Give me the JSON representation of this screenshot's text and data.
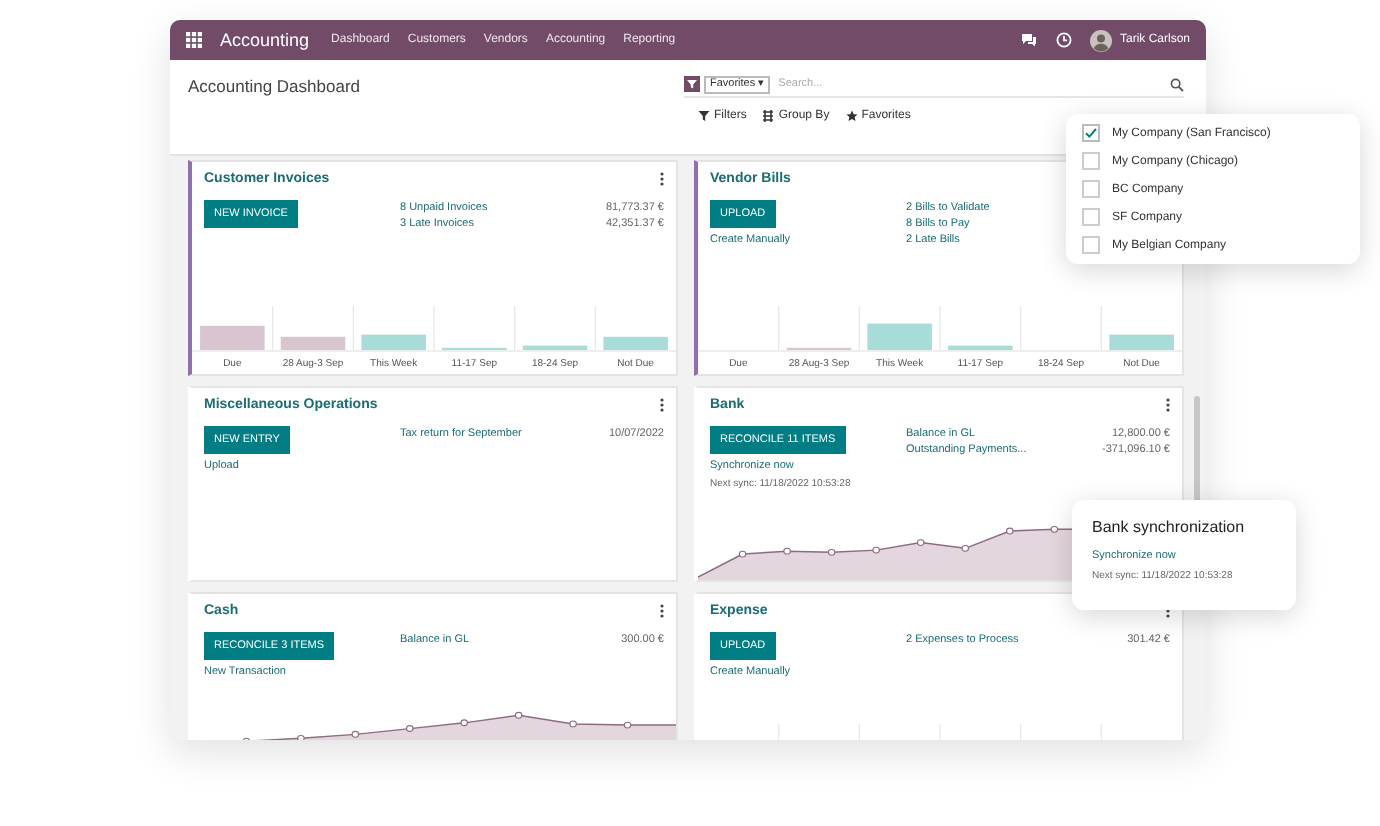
{
  "app": {
    "name": "Accounting",
    "menu": [
      "Dashboard",
      "Customers",
      "Vendors",
      "Accounting",
      "Reporting"
    ],
    "user": "Tarik Carlson"
  },
  "breadcrumb": "Accounting Dashboard",
  "search": {
    "facet": "Favorites",
    "facet_caret": "▾",
    "placeholder": "Search..."
  },
  "toolbar": [
    {
      "kind": "filter",
      "label": "Filters"
    },
    {
      "kind": "group",
      "label": "Group By"
    },
    {
      "kind": "star",
      "label": "Favorites"
    }
  ],
  "cards": [
    {
      "title": "Customer Invoices",
      "highlighted": true,
      "button": "NEW INVOICE",
      "lines": [
        {
          "label": "8 Unpaid Invoices",
          "value": "81,773.37 €"
        },
        {
          "label": "3 Late Invoices",
          "value": "42,351.37 €"
        }
      ],
      "chart": {
        "kind": "bars",
        "categories": [
          "Due",
          "28 Aug-3 Sep",
          "This Week",
          "11-17 Sep",
          "18-24 Sep",
          "Not Due"
        ]
      }
    },
    {
      "title": "Vendor Bills",
      "highlighted": true,
      "button": "UPLOAD",
      "links": [
        "Create Manually"
      ],
      "lines": [
        {
          "label": "2 Bills to Validate"
        },
        {
          "label": "8 Bills to Pay"
        },
        {
          "label": "2 Late Bills"
        }
      ],
      "chart": {
        "kind": "bars",
        "categories": [
          "Due",
          "28 Aug-3 Sep",
          "This Week",
          "11-17 Sep",
          "18-24 Sep",
          "Not Due"
        ]
      }
    },
    {
      "title": "Miscellaneous Operations",
      "highlighted": false,
      "button": "NEW ENTRY",
      "links": [
        "Upload"
      ],
      "lines": [
        {
          "label": "Tax return for September",
          "value": "10/07/2022"
        }
      ]
    },
    {
      "title": "Bank",
      "highlighted": false,
      "button": "RECONCILE 11 ITEMS",
      "links": [
        "Synchronize now"
      ],
      "note": "Next sync: 11/18/2022 10:53:28",
      "lines": [
        {
          "label": "Balance in GL",
          "value": "12,800.00 €"
        },
        {
          "label": "Outstanding Payments...",
          "value": "-371,096.10 €"
        }
      ],
      "chart": {
        "kind": "line"
      }
    },
    {
      "title": "Cash",
      "highlighted": false,
      "button": "RECONCILE 3 ITEMS",
      "links": [
        "New Transaction"
      ],
      "lines": [
        {
          "label": "Balance in GL",
          "value": "300.00 €"
        }
      ],
      "chart": {
        "kind": "line"
      }
    },
    {
      "title": "Expense",
      "highlighted": false,
      "button": "UPLOAD",
      "links": [
        "Create Manually"
      ],
      "lines": [
        {
          "label": "2 Expenses to Process",
          "value": "301.42 €"
        }
      ],
      "chart": {
        "kind": "bars"
      }
    }
  ],
  "companies": [
    {
      "name": "My Company (San Francisco)",
      "checked": true
    },
    {
      "name": "My Company (Chicago)",
      "checked": false
    },
    {
      "name": "BC Company",
      "checked": false
    },
    {
      "name": "SF Company",
      "checked": false
    },
    {
      "name": "My Belgian Company",
      "checked": false
    }
  ],
  "sync_popup": {
    "title": "Bank synchronization",
    "link": "Synchronize now",
    "note": "Next sync: 11/18/2022 10:53:28"
  }
}
